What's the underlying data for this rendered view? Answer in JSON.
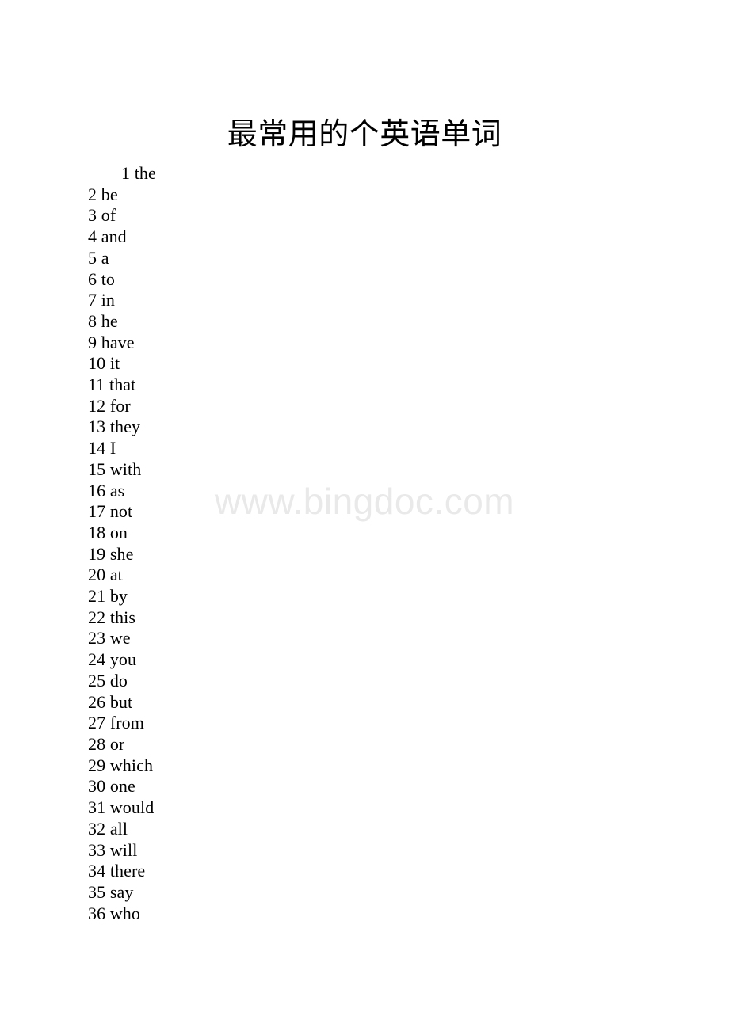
{
  "document": {
    "title": "最常用的个英语单词",
    "watermark": "www.bingdoc.com",
    "background_color": "#ffffff",
    "text_color": "#000000",
    "watermark_color": "#e9e9e9"
  },
  "word_list": {
    "entries": [
      {
        "number": "1",
        "word": "the",
        "indented": true
      },
      {
        "number": "2",
        "word": "be",
        "indented": false
      },
      {
        "number": "3",
        "word": "of",
        "indented": false
      },
      {
        "number": "4",
        "word": "and",
        "indented": false
      },
      {
        "number": "5",
        "word": "a",
        "indented": false
      },
      {
        "number": "6",
        "word": "to",
        "indented": false
      },
      {
        "number": "7",
        "word": "in",
        "indented": false
      },
      {
        "number": "8",
        "word": "he",
        "indented": false
      },
      {
        "number": "9",
        "word": "have",
        "indented": false
      },
      {
        "number": "10",
        "word": "it",
        "indented": false
      },
      {
        "number": "11",
        "word": "that",
        "indented": false
      },
      {
        "number": "12",
        "word": "for",
        "indented": false
      },
      {
        "number": "13",
        "word": "they",
        "indented": false
      },
      {
        "number": "14",
        "word": "I",
        "indented": false
      },
      {
        "number": "15",
        "word": "with",
        "indented": false
      },
      {
        "number": "16",
        "word": "as",
        "indented": false
      },
      {
        "number": "17",
        "word": "not",
        "indented": false
      },
      {
        "number": "18",
        "word": "on",
        "indented": false
      },
      {
        "number": "19",
        "word": "she",
        "indented": false
      },
      {
        "number": "20",
        "word": "at",
        "indented": false
      },
      {
        "number": "21",
        "word": "by",
        "indented": false
      },
      {
        "number": "22",
        "word": "this",
        "indented": false
      },
      {
        "number": "23",
        "word": "we",
        "indented": false
      },
      {
        "number": "24",
        "word": "you",
        "indented": false
      },
      {
        "number": "25",
        "word": "do",
        "indented": false
      },
      {
        "number": "26",
        "word": "but",
        "indented": false
      },
      {
        "number": "27",
        "word": "from",
        "indented": false
      },
      {
        "number": "28",
        "word": "or",
        "indented": false
      },
      {
        "number": "29",
        "word": "which",
        "indented": false
      },
      {
        "number": "30",
        "word": "one",
        "indented": false
      },
      {
        "number": "31",
        "word": "would",
        "indented": false
      },
      {
        "number": "32",
        "word": "all",
        "indented": false
      },
      {
        "number": "33",
        "word": "will",
        "indented": false
      },
      {
        "number": "34",
        "word": "there",
        "indented": false
      },
      {
        "number": "35",
        "word": "say",
        "indented": false
      },
      {
        "number": "36",
        "word": "who",
        "indented": false
      }
    ]
  }
}
